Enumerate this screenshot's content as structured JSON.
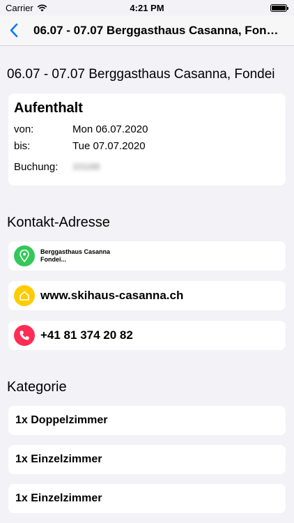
{
  "status_bar": {
    "carrier": "Carrier",
    "time": "4:21 PM"
  },
  "nav": {
    "title": "06.07 - 07.07 Berggasthaus Casanna, Fond..."
  },
  "heading": "06.07 - 07.07 Berggasthaus Casanna, Fondei",
  "stay": {
    "title": "Aufenthalt",
    "from_label": "von:",
    "from_value": "Mon 06.07.2020",
    "to_label": "bis:",
    "to_value": "Tue 07.07.2020",
    "booking_label": "Buchung:",
    "booking_value": "101168"
  },
  "contact": {
    "heading": "Kontakt-Adresse",
    "address_line1": "Berggasthaus Casanna",
    "address_line2": "Fondei...",
    "website": "www.skihaus-casanna.ch",
    "phone": "+41 81 374 20 82"
  },
  "category": {
    "heading": "Kategorie",
    "items": [
      "1x Doppelzimmer",
      "1x Einzelzimmer",
      "1x Einzelzimmer"
    ]
  },
  "colors": {
    "accent": "#007aff",
    "location": "#34c759",
    "web": "#ffcc00",
    "phone": "#ff2d55"
  }
}
